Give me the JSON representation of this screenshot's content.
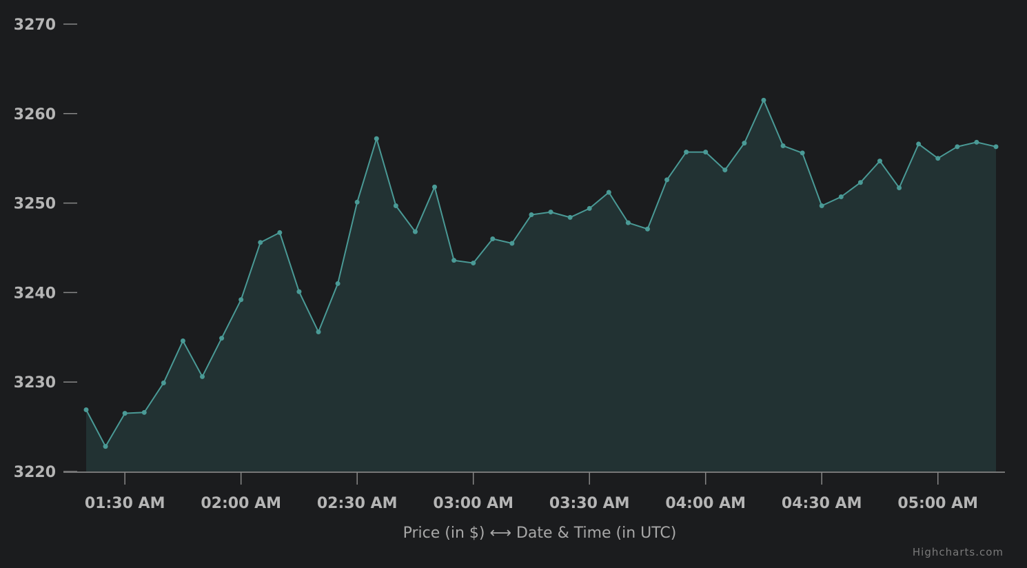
{
  "chart_data": {
    "type": "area",
    "title": "",
    "xlabel": "Price (in $) ⟷ Date & Time (in UTC)",
    "ylabel": "",
    "ylim": [
      3220,
      3270
    ],
    "yticks": [
      "3220",
      "3230",
      "3240",
      "3250",
      "3260",
      "3270"
    ],
    "xticks": [
      "01:30 AM",
      "02:00 AM",
      "02:30 AM",
      "03:00 AM",
      "03:30 AM",
      "04:00 AM",
      "04:30 AM",
      "05:00 AM"
    ],
    "x_start": "01:20 AM",
    "x_interval_minutes": 5,
    "values": [
      3226.9,
      3222.8,
      3226.5,
      3226.6,
      3229.9,
      3234.6,
      3230.6,
      3234.9,
      3239.2,
      3245.6,
      3246.7,
      3240.1,
      3235.6,
      3241.0,
      3250.1,
      3257.2,
      3249.7,
      3246.8,
      3251.8,
      3243.6,
      3243.3,
      3246.0,
      3245.5,
      3248.7,
      3249.0,
      3248.4,
      3249.4,
      3251.2,
      3247.8,
      3247.1,
      3252.6,
      3255.7,
      3255.7,
      3253.7,
      3256.7,
      3261.5,
      3256.4,
      3255.6,
      3249.7,
      3250.7,
      3252.3,
      3254.7,
      3251.7,
      3256.6,
      3255.0,
      3256.3,
      3256.8,
      3256.3
    ],
    "grid": false,
    "legend": "none",
    "colors": {
      "line": "#4a9a96",
      "fill": "#223233",
      "background": "#1b1c1e"
    }
  },
  "credits": "Highcharts.com"
}
